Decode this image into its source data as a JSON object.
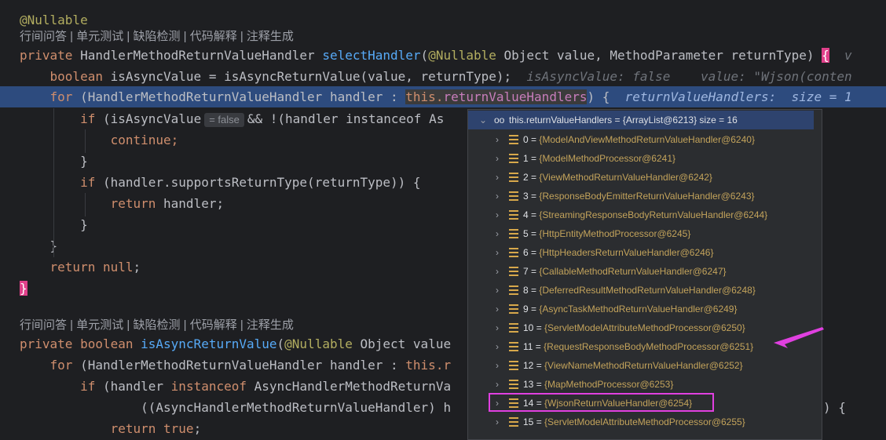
{
  "hints": {
    "top": "行间问答 | 单元测试 | 缺陷检测 | 代码解释 | 注释生成",
    "bottom": "行间问答 | 单元测试 | 缺陷检测 | 代码解释 | 注释生成"
  },
  "code": {
    "l1_annotation": "@Nullable",
    "l2_private": "private ",
    "l2_type": "HandlerMethodReturnValueHandler ",
    "l2_method": "selectHandler",
    "l2_paren_open": "(",
    "l2_param_ann": "@Nullable",
    "l2_params": " Object value, MethodParameter returnType) ",
    "l2_brace": "{",
    "l2_inline": "  v",
    "l3_indent": "    ",
    "l3_kw": "boolean ",
    "l3_code": "isAsyncValue = isAsyncReturnValue(value, returnType);",
    "l3_inline": "  isAsyncValue: false    value: \"Wjson(conten",
    "l4_indent": "    ",
    "l4_kw": "for ",
    "l4_code1": "(HandlerMethodReturnValueHandler handler : ",
    "l4_this": "this.",
    "l4_field": "returnValueHandlers",
    "l4_close": ") {",
    "l4_inline": "  returnValueHandlers:  size = 1",
    "l5_indent": "        ",
    "l5_kw": "if ",
    "l5_code1": "(isAsyncValue",
    "l5_chip": "= false",
    "l5_code2": "&& !(handler instanceof As",
    "l6_indent": "            ",
    "l6_kw": "continue;",
    "l7": "        }",
    "l8_indent": "        ",
    "l8_kw": "if ",
    "l8_code": "(handler.supportsReturnType(returnType)) {",
    "l9_indent": "            ",
    "l9_kw": "return ",
    "l9_code": "handler;",
    "l10": "        }",
    "l11": "    }",
    "l12_indent": "    ",
    "l12_kw": "return null",
    "l12_code": ";",
    "l13_brace": "}",
    "l14_private": "private ",
    "l14_kw": "boolean ",
    "l14_method": "isAsyncReturnValue",
    "l14_paren": "(",
    "l14_ann": "@Nullable",
    "l14_code": " Object value",
    "l15_indent": "    ",
    "l15_kw": "for ",
    "l15_code": "(HandlerMethodReturnValueHandler handler : ",
    "l15_this": "this.r",
    "l16_indent": "        ",
    "l16_kw1": "if ",
    "l16_code1": "(handler ",
    "l16_kw2": "instanceof ",
    "l16_code2": "AsyncHandlerMethodReturnVa",
    "l17_indent": "                ",
    "l17_code": "((AsyncHandlerMethodReturnValueHandler) h",
    "l17_tail": ") {",
    "l18_indent": "            ",
    "l18_kw": "return true",
    "l18_code": ";"
  },
  "popup": {
    "header_icon": "oo",
    "header_text": "this.returnValueHandlers = {ArrayList@6213}  size = 16",
    "rows": [
      {
        "index": "0",
        "value": "{ModelAndViewMethodReturnValueHandler@6240}"
      },
      {
        "index": "1",
        "value": "{ModelMethodProcessor@6241}"
      },
      {
        "index": "2",
        "value": "{ViewMethodReturnValueHandler@6242}"
      },
      {
        "index": "3",
        "value": "{ResponseBodyEmitterReturnValueHandler@6243}"
      },
      {
        "index": "4",
        "value": "{StreamingResponseBodyReturnValueHandler@6244}"
      },
      {
        "index": "5",
        "value": "{HttpEntityMethodProcessor@6245}"
      },
      {
        "index": "6",
        "value": "{HttpHeadersReturnValueHandler@6246}"
      },
      {
        "index": "7",
        "value": "{CallableMethodReturnValueHandler@6247}"
      },
      {
        "index": "8",
        "value": "{DeferredResultMethodReturnValueHandler@6248}"
      },
      {
        "index": "9",
        "value": "{AsyncTaskMethodReturnValueHandler@6249}"
      },
      {
        "index": "10",
        "value": "{ServletModelAttributeMethodProcessor@6250}"
      },
      {
        "index": "11",
        "value": "{RequestResponseBodyMethodProcessor@6251}"
      },
      {
        "index": "12",
        "value": "{ViewNameMethodReturnValueHandler@6252}"
      },
      {
        "index": "13",
        "value": "{MapMethodProcessor@6253}"
      },
      {
        "index": "14",
        "value": "{WjsonReturnValueHandler@6254}"
      },
      {
        "index": "15",
        "value": "{ServletModelAttributeMethodProcessor@6255}"
      }
    ],
    "eq": " = "
  },
  "colors": {
    "editor_bg": "#1e1f22",
    "selection_bg": "#2d4b7e",
    "keyword": "#cf8e6d",
    "method": "#57aaf7",
    "field": "#c77dbb",
    "annotation": "#b3ae60",
    "highlight_box": "#e040e0"
  }
}
